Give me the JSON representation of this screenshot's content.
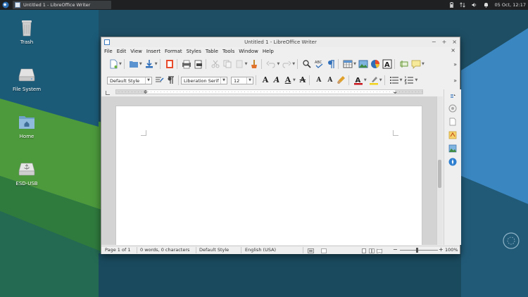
{
  "taskbar": {
    "window_title": "Untitled 1 - LibreOffice Writer",
    "datetime": "05 Oct, 12:17"
  },
  "desktop": {
    "icons": [
      {
        "label": "Trash"
      },
      {
        "label": "File System"
      },
      {
        "label": "Home"
      },
      {
        "label": "ESD-USB"
      }
    ]
  },
  "window": {
    "title": "Untitled 1 - LibreOffice Writer",
    "menu": [
      "File",
      "Edit",
      "View",
      "Insert",
      "Format",
      "Styles",
      "Table",
      "Tools",
      "Window",
      "Help"
    ],
    "more_glyph": "»"
  },
  "formatting": {
    "paragraph_style": "Default Style",
    "font_name": "Liberation Serif",
    "font_size": "12"
  },
  "statusbar": {
    "page": "Page 1 of 1",
    "words": "0 words, 0 characters",
    "page_style": "Default Style",
    "language": "English (USA)",
    "zoom": "100%"
  },
  "colors": {
    "desktop_bg": "#1d4d63",
    "desktop_green": "#4d9a3a",
    "taskbar_bg": "#1e2022",
    "font_color_red": "#c8151b",
    "highlight_yellow": "#f2d21b"
  }
}
